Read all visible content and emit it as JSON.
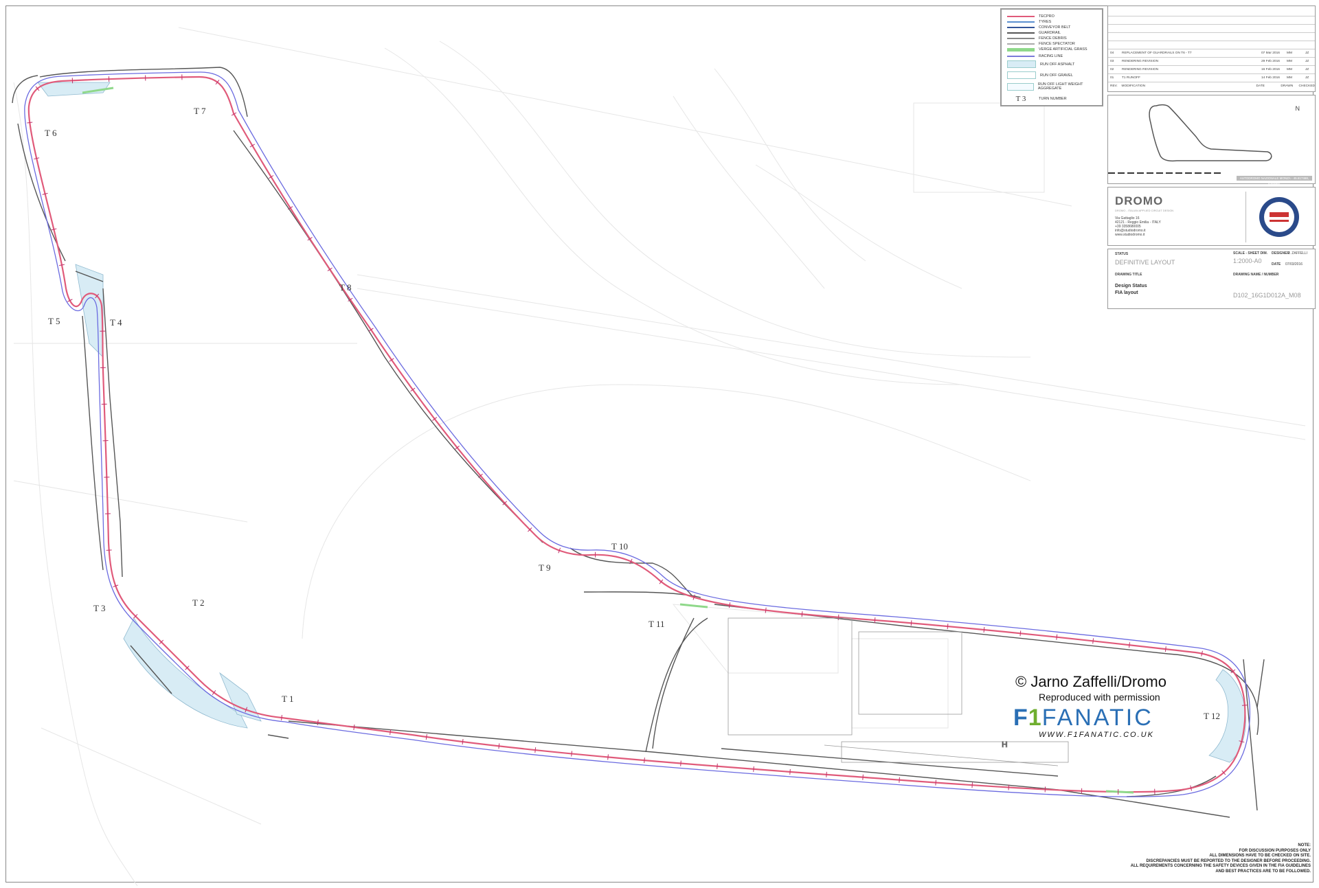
{
  "turns": [
    "T 1",
    "T 2",
    "T 3",
    "T 4",
    "T 5",
    "T 6",
    "T 7",
    "T 8",
    "T 9",
    "T 10",
    "T 11",
    "T 12"
  ],
  "legend": {
    "items": [
      {
        "label": "TECPRO",
        "color": "#e05a7a",
        "kind": "line"
      },
      {
        "label": "TYRES",
        "color": "#5a8fd0",
        "kind": "line"
      },
      {
        "label": "CONVEYOR BELT",
        "color": "#335599",
        "kind": "line"
      },
      {
        "label": "GUARDRAIL",
        "color": "#555555",
        "kind": "line"
      },
      {
        "label": "FENCE DEBRIS",
        "color": "#888888",
        "kind": "line"
      },
      {
        "label": "FENCE SPECTATOR",
        "color": "#aaaaaa",
        "kind": "line"
      },
      {
        "label": "VERGE ARTIFICIAL GRASS",
        "color": "#8fd88a",
        "kind": "line"
      },
      {
        "label": "RACING LINE",
        "color": "#7a7ad8",
        "kind": "line"
      },
      {
        "label": "RUN OFF ASPHALT",
        "color": "#d8ecf5",
        "kind": "box"
      },
      {
        "label": "RUN OFF GRAVEL",
        "color": "#ffffff",
        "kind": "box"
      },
      {
        "label": "RUN OFF LIGHT WEIGHT AGGREGATE",
        "color": "#f4fbff",
        "kind": "box"
      }
    ],
    "turn_symbol": "T 3",
    "turn_label": "TURN NUMBER"
  },
  "revisions": {
    "rows": [
      {
        "rev": "04",
        "mod": "REPLACEMENT OF GUARDRAILS ON T6 - T7",
        "date": "07 Mar 2016",
        "drawn": "MM",
        "checked": "JZ"
      },
      {
        "rev": "03",
        "mod": "RENDERING REVISION",
        "date": "29 Feb 2016",
        "drawn": "MM",
        "checked": "JZ"
      },
      {
        "rev": "02",
        "mod": "RENDERING REVISION",
        "date": "16 Feb 2016",
        "drawn": "MM",
        "checked": "JZ"
      },
      {
        "rev": "01",
        "mod": "T1 RUNOFF",
        "date": "14 Feb 2016",
        "drawn": "MM",
        "checked": "JZ"
      }
    ],
    "header": {
      "rev": "REV.",
      "mod": "MODIFICATION",
      "date": "DATE",
      "drawn": "DRAWN",
      "checked": "CHECKED"
    }
  },
  "minimap": {
    "north": "N",
    "caption": "AUTODROMO NAZIONALE MONZA - 45.617468, 9.281137"
  },
  "company": {
    "name": "DROMO",
    "tagline": "DROMO - ITALIAN APPLIED CIRCUIT DESIGN",
    "address": "Via Gattaglio 16\n42121 - Reggio Emilia - ITALY\n+39 3358680005\ninfo@studiodromo.it\nwww.studiodromo.it"
  },
  "status": {
    "status_label": "STATUS",
    "status_value": "DEFINITIVE LAYOUT",
    "scale_label": "SCALE - SHEET DIM.",
    "scale_value": "1:2000-A0",
    "designer_label": "DESIGNER",
    "designer_value": "J. ZAFFELLI",
    "date_label": "DATE",
    "date_value": "07/03/2016",
    "title_label": "DRAWING TITLE",
    "title_line1": "Design Status",
    "title_line2": "FIA layout",
    "number_label": "DRAWING NAME / NUMBER",
    "number_value": "D102_16G1D012A_M08"
  },
  "watermark": {
    "copyright": "© Jarno Zaffelli/Dromo",
    "permission": "Reproduced with permission",
    "brand_a": "F",
    "brand_b": "1",
    "brand_c": "FANATIC",
    "url": "WWW.F1FANATIC.CO.UK"
  },
  "notes": [
    "NOTE:",
    "FOR DISCUSSION PURPOSES ONLY",
    "ALL DIMENSIONS HAVE TO BE CHECKED ON SITE.",
    "DISCREPANCIES MUST BE REPORTED TO THE DESIGNER BEFORE PROCEEDING.",
    "ALL REQUIREMENTS CONCERNING THE SAFETY DEVICES GIVEN IN THE FIA GUIDELINES",
    "AND BEST PRACTICES ARE TO BE FOLLOWED."
  ],
  "colors": {
    "track": "#e05a7a",
    "racing_line": "#6a6ae0",
    "guardrail": "#555555",
    "runoff": "#d8ecf5",
    "verge": "#8fd88a"
  }
}
